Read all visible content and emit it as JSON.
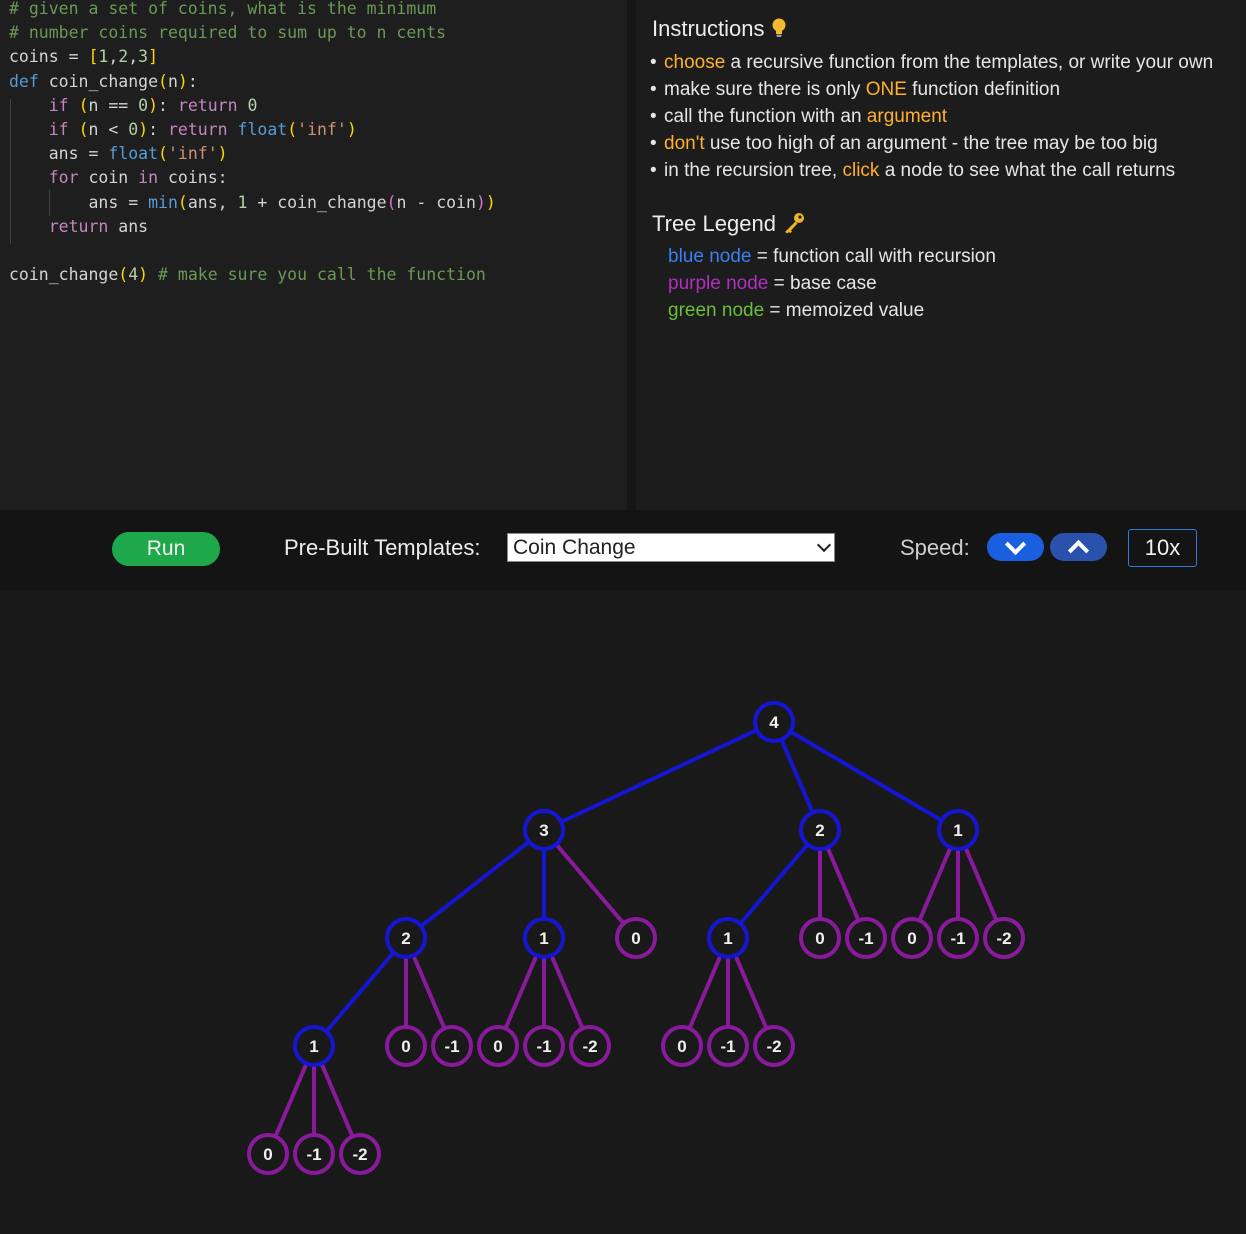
{
  "editor": {
    "lines": [
      [
        {
          "t": "# given a set of coins, what is the minimum",
          "c": "cm"
        }
      ],
      [
        {
          "t": "# number coins required to sum up to n cents",
          "c": "cm"
        }
      ],
      [
        {
          "t": "coins = ",
          "c": ""
        },
        {
          "t": "[",
          "c": "br1"
        },
        {
          "t": "1",
          "c": "num"
        },
        {
          "t": ",",
          "c": ""
        },
        {
          "t": "2",
          "c": "num"
        },
        {
          "t": ",",
          "c": ""
        },
        {
          "t": "3",
          "c": "num"
        },
        {
          "t": "]",
          "c": "br1"
        }
      ],
      [
        {
          "t": "def ",
          "c": "kw"
        },
        {
          "t": "coin_change",
          "c": ""
        },
        {
          "t": "(",
          "c": "br1"
        },
        {
          "t": "n",
          "c": ""
        },
        {
          "t": ")",
          "c": "br1"
        },
        {
          "t": ":",
          "c": ""
        }
      ],
      [
        {
          "t": "    ",
          "c": ""
        },
        {
          "t": "if ",
          "c": "kwc"
        },
        {
          "t": "(",
          "c": "br1"
        },
        {
          "t": "n == ",
          "c": ""
        },
        {
          "t": "0",
          "c": "num"
        },
        {
          "t": ")",
          "c": "br1"
        },
        {
          "t": ": ",
          "c": ""
        },
        {
          "t": "return ",
          "c": "kwc"
        },
        {
          "t": "0",
          "c": "num"
        }
      ],
      [
        {
          "t": "    ",
          "c": ""
        },
        {
          "t": "if ",
          "c": "kwc"
        },
        {
          "t": "(",
          "c": "br1"
        },
        {
          "t": "n < ",
          "c": ""
        },
        {
          "t": "0",
          "c": "num"
        },
        {
          "t": ")",
          "c": "br1"
        },
        {
          "t": ": ",
          "c": ""
        },
        {
          "t": "return ",
          "c": "kwc"
        },
        {
          "t": "float",
          "c": "bl"
        },
        {
          "t": "(",
          "c": "br1"
        },
        {
          "t": "'inf'",
          "c": "str"
        },
        {
          "t": ")",
          "c": "br1"
        }
      ],
      [
        {
          "t": "    ans = ",
          "c": ""
        },
        {
          "t": "float",
          "c": "bl"
        },
        {
          "t": "(",
          "c": "br1"
        },
        {
          "t": "'inf'",
          "c": "str"
        },
        {
          "t": ")",
          "c": "br1"
        }
      ],
      [
        {
          "t": "    ",
          "c": ""
        },
        {
          "t": "for ",
          "c": "kwc"
        },
        {
          "t": "coin ",
          "c": ""
        },
        {
          "t": "in ",
          "c": "kwc"
        },
        {
          "t": "coins:",
          "c": ""
        }
      ],
      [
        {
          "t": "        ans = ",
          "c": ""
        },
        {
          "t": "min",
          "c": "bl"
        },
        {
          "t": "(",
          "c": "br1"
        },
        {
          "t": "ans, ",
          "c": ""
        },
        {
          "t": "1",
          "c": "num"
        },
        {
          "t": " + coin_change",
          "c": ""
        },
        {
          "t": "(",
          "c": "br2"
        },
        {
          "t": "n - coin",
          "c": ""
        },
        {
          "t": ")",
          "c": "br2"
        },
        {
          "t": ")",
          "c": "br1"
        }
      ],
      [
        {
          "t": "    ",
          "c": ""
        },
        {
          "t": "return ",
          "c": "kwc"
        },
        {
          "t": "ans",
          "c": ""
        }
      ],
      [
        {
          "t": "",
          "c": ""
        }
      ],
      [
        {
          "t": "coin_change",
          "c": ""
        },
        {
          "t": "(",
          "c": "br1"
        },
        {
          "t": "4",
          "c": "num"
        },
        {
          "t": ")",
          "c": "br1"
        },
        {
          "t": " ",
          "c": ""
        },
        {
          "t": "# make sure you call the function",
          "c": "cm"
        }
      ]
    ]
  },
  "instructions": {
    "title": "Instructions",
    "icon": "lightbulb-icon",
    "items": [
      {
        "hl": "choose",
        "rest": " a recursive function from the templates, or write your own"
      },
      {
        "pre": "make sure there is only ",
        "hl": "ONE",
        "rest": " function definition"
      },
      {
        "pre": "call the function with an ",
        "hl": "argument",
        "rest": ""
      },
      {
        "hl": "don't",
        "rest": " use too high of an argument - the tree may be too big"
      },
      {
        "pre": "in the recursion tree, ",
        "hl": "click",
        "rest": " a node to see what the call returns"
      }
    ]
  },
  "legend": {
    "title": "Tree Legend",
    "icon": "key-icon",
    "items": [
      {
        "label": "blue node",
        "desc": " = function call with recursion",
        "color": "#3b7ff0"
      },
      {
        "label": "purple node",
        "desc": " = base case",
        "color": "#b02fc0"
      },
      {
        "label": "green node",
        "desc": " = memoized value",
        "color": "#6abf3a"
      }
    ]
  },
  "toolbar": {
    "run_label": "Run",
    "templates_label": "Pre-Built Templates:",
    "template_selected": "Coin Change",
    "speed_label": "Speed:",
    "speed_value": "10x"
  },
  "colors": {
    "recursive": "#1515d4",
    "base": "#8a1a9c",
    "memo": "#3fb33f",
    "bg": "#191919"
  },
  "tree": {
    "root": {
      "v": "4",
      "t": "r",
      "c": [
        {
          "v": "3",
          "t": "r",
          "c": [
            {
              "v": "2",
              "t": "r",
              "c": [
                {
                  "v": "1",
                  "t": "r",
                  "c": [
                    {
                      "v": "0",
                      "t": "b"
                    },
                    {
                      "v": "-1",
                      "t": "b"
                    },
                    {
                      "v": "-2",
                      "t": "b"
                    }
                  ]
                },
                {
                  "v": "0",
                  "t": "b"
                },
                {
                  "v": "-1",
                  "t": "b"
                }
              ]
            },
            {
              "v": "1",
              "t": "r",
              "c": [
                {
                  "v": "0",
                  "t": "b"
                },
                {
                  "v": "-1",
                  "t": "b"
                },
                {
                  "v": "-2",
                  "t": "b"
                }
              ]
            },
            {
              "v": "0",
              "t": "b"
            }
          ]
        },
        {
          "v": "2",
          "t": "r",
          "c": [
            {
              "v": "1",
              "t": "r",
              "c": [
                {
                  "v": "0",
                  "t": "b"
                },
                {
                  "v": "-1",
                  "t": "b"
                },
                {
                  "v": "-2",
                  "t": "b"
                }
              ]
            },
            {
              "v": "0",
              "t": "b"
            },
            {
              "v": "-1",
              "t": "b"
            }
          ]
        },
        {
          "v": "1",
          "t": "r",
          "c": [
            {
              "v": "0",
              "t": "b"
            },
            {
              "v": "-1",
              "t": "b"
            },
            {
              "v": "-2",
              "t": "b"
            }
          ]
        }
      ]
    }
  }
}
